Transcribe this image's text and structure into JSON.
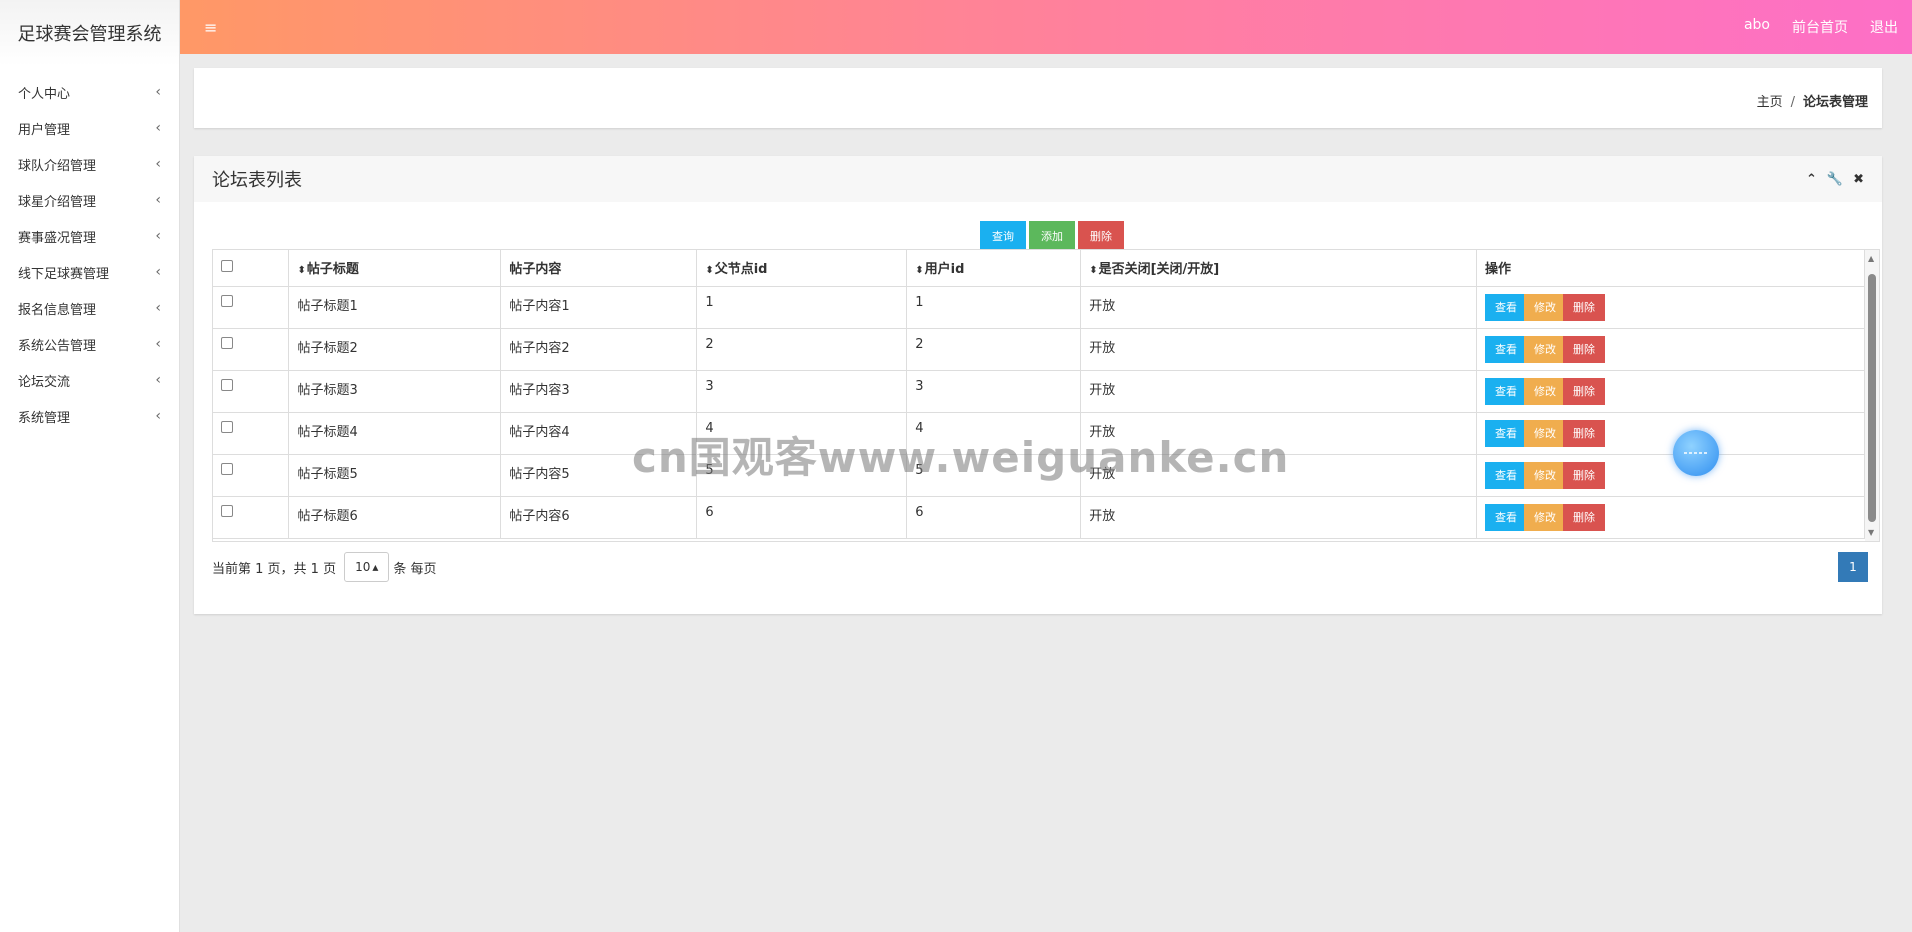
{
  "app": {
    "title": "足球赛会管理系统"
  },
  "sidebar": {
    "items": [
      {
        "label": "个人中心"
      },
      {
        "label": "用户管理"
      },
      {
        "label": "球队介绍管理"
      },
      {
        "label": "球星介绍管理"
      },
      {
        "label": "赛事盛况管理"
      },
      {
        "label": "线下足球赛管理"
      },
      {
        "label": "报名信息管理"
      },
      {
        "label": "系统公告管理"
      },
      {
        "label": "论坛交流"
      },
      {
        "label": "系统管理"
      }
    ],
    "chevron": "‹"
  },
  "topbar": {
    "menu_icon": "≡",
    "user": "abo",
    "home_link": "前台首页",
    "logout": "退出"
  },
  "breadcrumb": {
    "home": "主页",
    "sep": "/",
    "current": "论坛表管理"
  },
  "panel": {
    "title": "论坛表列表",
    "tools": {
      "collapse": "⌃",
      "settings": "🔧",
      "close": "✖"
    }
  },
  "toolbar": {
    "query": "查询",
    "add": "添加",
    "delete": "删除"
  },
  "table": {
    "sort_icon": "⬍",
    "headers": {
      "title": "帖子标题",
      "content": "帖子内容",
      "parent_id": "父节点id",
      "user_id": "用户id",
      "closed": "是否关闭[关闭/开放]",
      "ops": "操作"
    },
    "row_actions": {
      "view": "查看",
      "edit": "修改",
      "delete": "删除"
    },
    "rows": [
      {
        "title": "帖子标题1",
        "content": "帖子内容1",
        "parent_id": "1",
        "user_id": "1",
        "closed": "开放"
      },
      {
        "title": "帖子标题2",
        "content": "帖子内容2",
        "parent_id": "2",
        "user_id": "2",
        "closed": "开放"
      },
      {
        "title": "帖子标题3",
        "content": "帖子内容3",
        "parent_id": "3",
        "user_id": "3",
        "closed": "开放"
      },
      {
        "title": "帖子标题4",
        "content": "帖子内容4",
        "parent_id": "4",
        "user_id": "4",
        "closed": "开放"
      },
      {
        "title": "帖子标题5",
        "content": "帖子内容5",
        "parent_id": "5",
        "user_id": "5",
        "closed": "开放"
      },
      {
        "title": "帖子标题6",
        "content": "帖子内容6",
        "parent_id": "6",
        "user_id": "6",
        "closed": "开放"
      }
    ]
  },
  "pager": {
    "info": "当前第 1 页，共 1 页",
    "page_size": "10",
    "page_size_suffix": "条 每页",
    "current_page": "1"
  },
  "watermark": "cn国观客www.weiguanke.cn",
  "colors": {
    "topbar_gradient": [
      "#ff9866",
      "#ff7fa0",
      "#fd6fc7"
    ],
    "btn_blue": "#1ab0f0",
    "btn_green": "#5cb85c",
    "btn_red": "#d9534f",
    "btn_orange": "#f0ad4e",
    "page_active": "#337ab7"
  }
}
